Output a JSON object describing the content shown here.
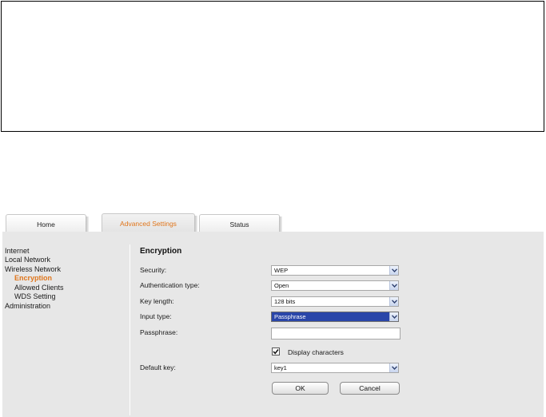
{
  "tabs": [
    {
      "label": "Home"
    },
    {
      "label": "Advanced Settings"
    },
    {
      "label": "Status"
    }
  ],
  "sidebar": {
    "items": [
      {
        "label": "Internet"
      },
      {
        "label": "Local Network"
      },
      {
        "label": "Wireless Network"
      },
      {
        "label": "Encryption",
        "active": true
      },
      {
        "label": "Allowed Clients"
      },
      {
        "label": "WDS Setting"
      },
      {
        "label": "Administration"
      }
    ]
  },
  "form": {
    "title": "Encryption",
    "security": {
      "label": "Security:",
      "value": "WEP"
    },
    "auth_type": {
      "label": "Authentication type:",
      "value": "Open"
    },
    "key_length": {
      "label": "Key length:",
      "value": "128 bits"
    },
    "input_type": {
      "label": "Input type:",
      "value": "Passphrase"
    },
    "passphrase": {
      "label": "Passphrase:",
      "value": ""
    },
    "display_chars": {
      "label": "Display characters",
      "checked": true
    },
    "default_key": {
      "label": "Default key:",
      "value": "key1"
    },
    "ok_label": "OK",
    "cancel_label": "Cancel"
  },
  "colors": {
    "accent": "#e0761c",
    "panel": "#e7e7e7",
    "selection": "#2a46a9"
  }
}
